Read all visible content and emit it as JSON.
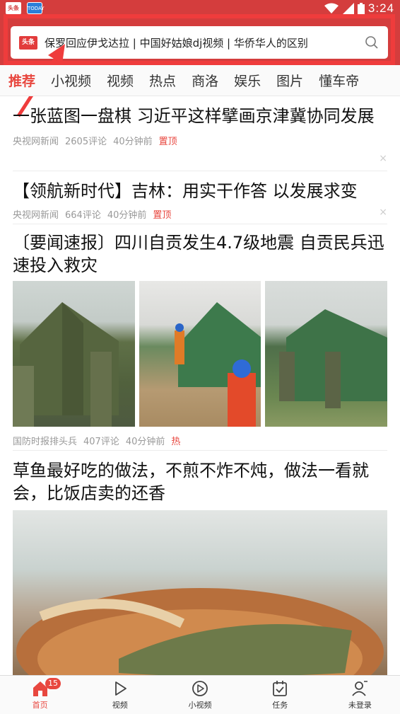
{
  "status_bar": {
    "app1": "头条",
    "app2": "TODAY",
    "time": "3:24"
  },
  "search": {
    "logo": "头条",
    "hot_words": "保罗回应伊戈达拉 | 中国好姑娘dj视频 | 华侨华人的区别",
    "icon": "search-icon"
  },
  "tabs": [
    "推荐",
    "小视频",
    "视频",
    "热点",
    "商洛",
    "娱乐",
    "图片",
    "懂车帝"
  ],
  "articles": [
    {
      "title": "一张蓝图一盘棋 习近平这样擘画京津冀协同发展",
      "source": "央视网新闻",
      "comments": "2605评论",
      "time": "40分钟前",
      "tag": "置顶"
    },
    {
      "title": "【领航新时代】吉林：用实干作答 以发展求变",
      "source": "央视网新闻",
      "comments": "664评论",
      "time": "40分钟前",
      "tag": "置顶"
    },
    {
      "title": "〔要闻速报〕四川自贡发生4.7级地震 自贡民兵迅速投入救灾",
      "source": "国防时报排头兵",
      "comments": "407评论",
      "time": "40分钟前",
      "tag": "热"
    },
    {
      "title": "草鱼最好吃的做法，不煎不炸不炖，做法一看就会，比饭店卖的还香"
    }
  ],
  "close_glyph": "×",
  "bottom_nav": [
    {
      "label": "首页",
      "icon": "home-icon",
      "badge": "15"
    },
    {
      "label": "视频",
      "icon": "play-icon"
    },
    {
      "label": "小视频",
      "icon": "small-video-icon"
    },
    {
      "label": "任务",
      "icon": "task-icon"
    },
    {
      "label": "未登录",
      "icon": "user-icon"
    }
  ],
  "colors": {
    "header_red": "#d43d3d",
    "accent_red": "#e8473f",
    "annotation_red": "#ef3c3c"
  }
}
